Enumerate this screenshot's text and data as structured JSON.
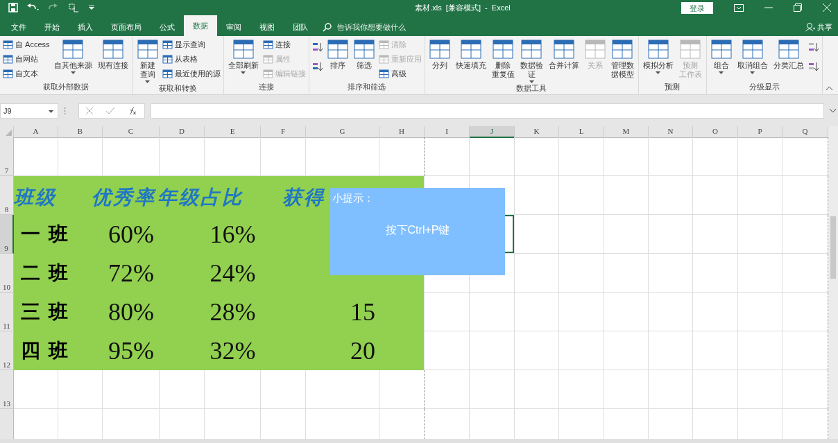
{
  "title_bar": {
    "title": "素材.xls  [兼容模式]  -  Excel",
    "login": "登录"
  },
  "tabs": [
    {
      "label": "文件",
      "selected": false
    },
    {
      "label": "开始",
      "selected": false
    },
    {
      "label": "插入",
      "selected": false
    },
    {
      "label": "页面布局",
      "selected": false
    },
    {
      "label": "公式",
      "selected": false
    },
    {
      "label": "数据",
      "selected": true
    },
    {
      "label": "审阅",
      "selected": false
    },
    {
      "label": "视图",
      "selected": false
    },
    {
      "label": "团队",
      "selected": false
    }
  ],
  "search": {
    "placeholder": "告诉我你想要做什么"
  },
  "share": "共享",
  "ribbon": {
    "groups": [
      {
        "label": "获取外部数据",
        "items": [
          {
            "kind": "stack",
            "items": [
              {
                "label": "自 Access",
                "disabled": false
              },
              {
                "label": "自网站",
                "disabled": false
              },
              {
                "label": "自文本",
                "disabled": false
              }
            ]
          },
          {
            "kind": "large",
            "label": "自其他来源",
            "dropdown": true,
            "disabled": false
          },
          {
            "kind": "large",
            "label": "现有连接",
            "dropdown": false,
            "disabled": false
          }
        ]
      },
      {
        "label": "获取和转换",
        "items": [
          {
            "kind": "large",
            "lines": [
              "新建",
              "查询"
            ],
            "dropdown": true,
            "disabled": false
          },
          {
            "kind": "stack",
            "items": [
              {
                "label": "显示查询",
                "disabled": false
              },
              {
                "label": "从表格",
                "disabled": false
              },
              {
                "label": "最近使用的源",
                "disabled": false
              }
            ]
          }
        ]
      },
      {
        "label": "连接",
        "items": [
          {
            "kind": "large",
            "label": "全部刷新",
            "dropdown": true,
            "disabled": false
          },
          {
            "kind": "stack",
            "items": [
              {
                "label": "连接",
                "disabled": false
              },
              {
                "label": "属性",
                "disabled": true
              },
              {
                "label": "编辑链接",
                "disabled": true
              }
            ]
          }
        ]
      },
      {
        "label": "排序和筛选",
        "items": [
          {
            "kind": "icons",
            "items": [
              {
                "disabled": false
              },
              {
                "disabled": false
              }
            ]
          },
          {
            "kind": "large",
            "label": "排序",
            "dropdown": false,
            "disabled": false
          },
          {
            "kind": "large",
            "label": "筛选",
            "dropdown": false,
            "disabled": false
          },
          {
            "kind": "stack",
            "items": [
              {
                "label": "清除",
                "disabled": true
              },
              {
                "label": "重新应用",
                "disabled": true
              },
              {
                "label": "高级",
                "disabled": false
              }
            ]
          }
        ]
      },
      {
        "label": "数据工具",
        "items": [
          {
            "kind": "large",
            "label": "分列",
            "dropdown": false,
            "disabled": false
          },
          {
            "kind": "large",
            "label": "快速填充",
            "dropdown": false,
            "disabled": false
          },
          {
            "kind": "large",
            "lines": [
              "删除",
              "重复值"
            ],
            "dropdown": false,
            "disabled": false
          },
          {
            "kind": "large",
            "lines": [
              "数据验",
              "证"
            ],
            "dropdown": true,
            "disabled": false
          },
          {
            "kind": "large",
            "label": "合并计算",
            "dropdown": false,
            "disabled": false
          },
          {
            "kind": "large",
            "label": "关系",
            "dropdown": false,
            "disabled": true
          },
          {
            "kind": "large",
            "lines": [
              "管理数",
              "据模型"
            ],
            "dropdown": false,
            "disabled": false
          }
        ]
      },
      {
        "label": "预测",
        "items": [
          {
            "kind": "large",
            "label": "模拟分析",
            "dropdown": true,
            "disabled": false
          },
          {
            "kind": "large",
            "lines": [
              "预测",
              "工作表"
            ],
            "dropdown": false,
            "disabled": true
          }
        ]
      },
      {
        "label": "分级显示",
        "items": [
          {
            "kind": "large",
            "label": "组合",
            "dropdown": true,
            "disabled": false
          },
          {
            "kind": "large",
            "label": "取消组合",
            "dropdown": true,
            "disabled": false
          },
          {
            "kind": "large",
            "label": "分类汇总",
            "dropdown": false,
            "disabled": false
          },
          {
            "kind": "icons",
            "items": [
              {
                "disabled": true
              },
              {
                "disabled": true
              }
            ]
          }
        ]
      }
    ]
  },
  "formula_bar": {
    "name_box": "J9"
  },
  "sheet": {
    "columns": [
      {
        "label": "A",
        "selected": false
      },
      {
        "label": "B",
        "selected": false
      },
      {
        "label": "C",
        "selected": false
      },
      {
        "label": "D",
        "selected": false
      },
      {
        "label": "E",
        "selected": false
      },
      {
        "label": "F",
        "selected": false
      },
      {
        "label": "G",
        "selected": false
      },
      {
        "label": "H",
        "selected": false
      },
      {
        "label": "I",
        "selected": false
      },
      {
        "label": "J",
        "selected": true
      },
      {
        "label": "K",
        "selected": false
      },
      {
        "label": "L",
        "selected": false
      },
      {
        "label": "M",
        "selected": false
      },
      {
        "label": "N",
        "selected": false
      },
      {
        "label": "O",
        "selected": false
      },
      {
        "label": "P",
        "selected": false
      },
      {
        "label": "Q",
        "selected": false
      }
    ],
    "rows": [
      {
        "label": "7",
        "selected": false
      },
      {
        "label": "8",
        "selected": false
      },
      {
        "label": "9",
        "selected": true
      },
      {
        "label": "10",
        "selected": false
      },
      {
        "label": "11",
        "selected": false
      },
      {
        "label": "12",
        "selected": false
      },
      {
        "label": "13",
        "selected": false
      },
      {
        "selected": false
      }
    ],
    "table": {
      "headers": [
        "班级",
        "优秀率",
        "年级占比",
        "获得"
      ],
      "rows": [
        {
          "class": "一班",
          "excellent_rate": "60%",
          "grade_share": "16%"
        },
        {
          "class": "二班",
          "excellent_rate": "72%",
          "grade_share": "24%"
        },
        {
          "class": "三班",
          "excellent_rate": "80%",
          "grade_share": "28%",
          "awards": "15"
        },
        {
          "class": "四班",
          "excellent_rate": "95%",
          "grade_share": "32%",
          "awards": "20"
        }
      ]
    }
  },
  "tip": {
    "title": "小提示：",
    "body": "按下Ctrl+P键"
  }
}
